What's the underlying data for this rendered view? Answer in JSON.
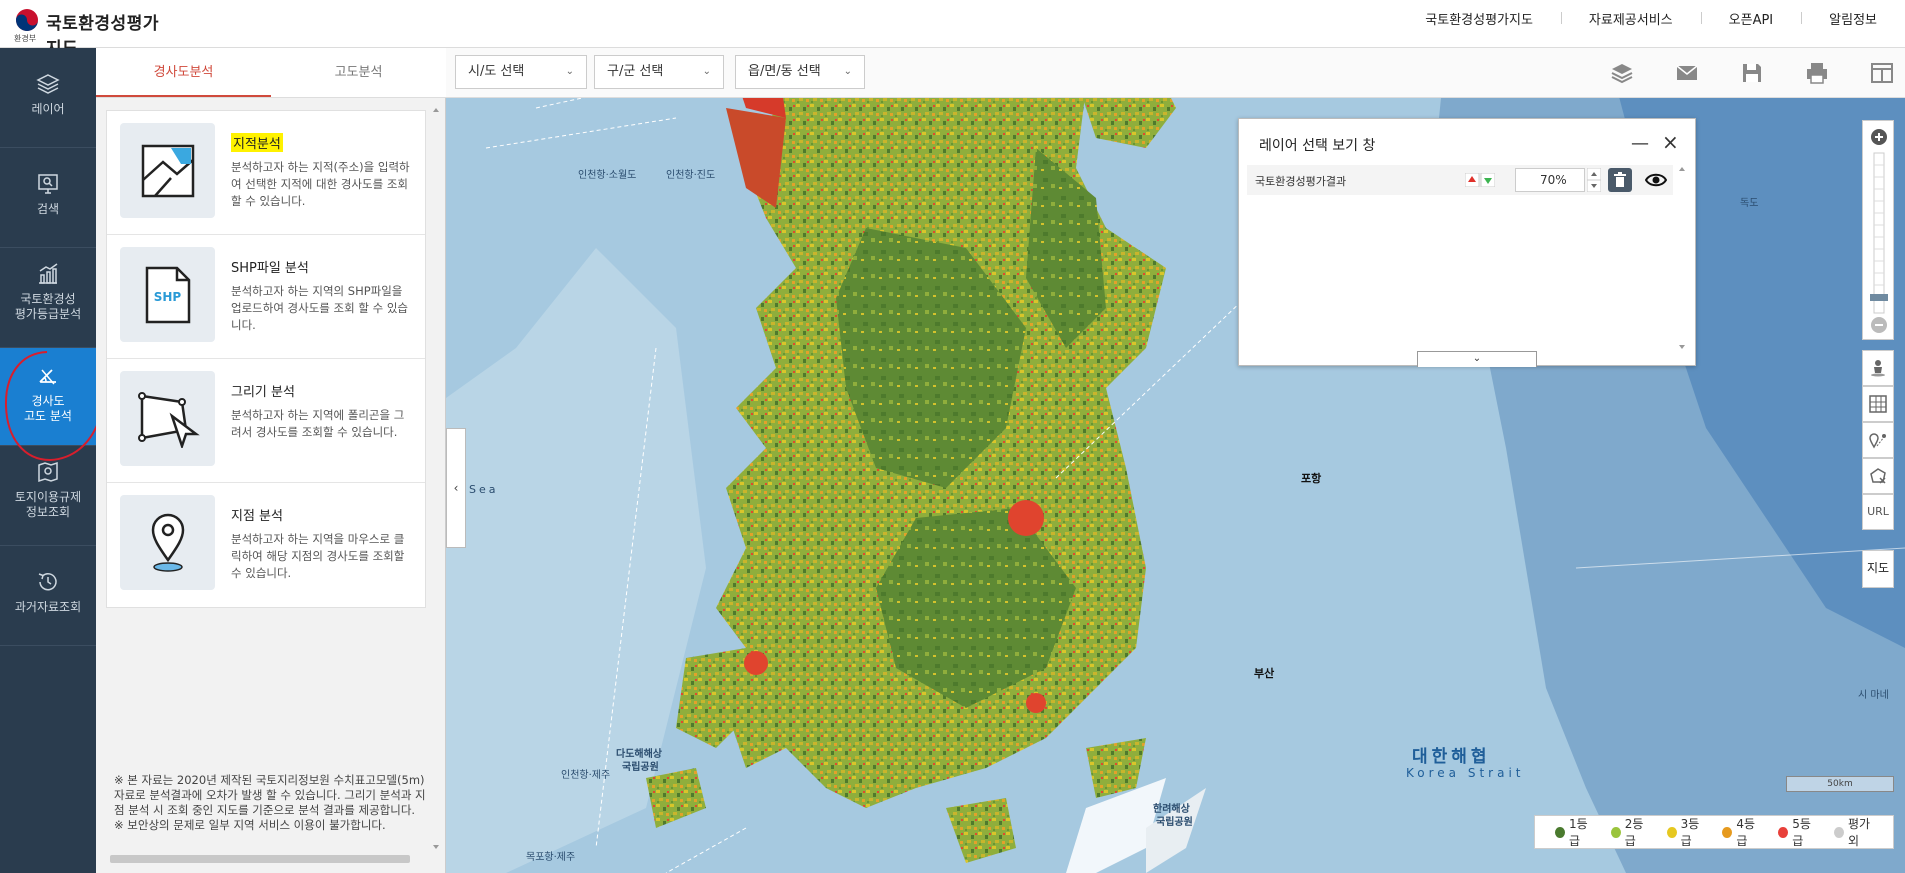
{
  "header": {
    "ministry": "환경부",
    "title": "국토환경성평가지도",
    "nav": [
      "국토환경성평가지도",
      "자료제공서비스",
      "오픈API",
      "알림정보"
    ]
  },
  "leftnav": {
    "layer": "레이어",
    "search": "검색",
    "grade_line1": "국토환경성",
    "grade_line2": "평가등급분석",
    "slope_line1": "경사도",
    "slope_line2": "고도 분석",
    "land_line1": "토지이용규제",
    "land_line2": "정보조회",
    "history": "과거자료조회"
  },
  "panel": {
    "tabs": [
      "경사도분석",
      "고도분석"
    ],
    "cards": [
      {
        "title": "지적분석",
        "desc": "분석하고자 하는 지적(주소)을 입력하여 선택한 지적에 대한 경사도를 조회할 수 있습니다."
      },
      {
        "title": "SHP파일 분석",
        "desc": "분석하고자 하는 지역의 SHP파일을 업로드하여 경사도를 조회 할 수 있습니다."
      },
      {
        "title": "그리기 분석",
        "desc": "분석하고자 하는 지역에 폴리곤을 그려서 경사도를 조회할 수 있습니다."
      },
      {
        "title": "지점 분석",
        "desc": "분석하고자 하는 지역을 마우스로 클릭하여 해당 지점의 경사도를 조회할 수 있습니다."
      }
    ],
    "shp_label": "SHP",
    "notice1": "※ 본 자료는 2020년 제작된 국토지리정보원 수치표고모델(5m) 자료로 분석결과에 오차가 발생 할 수 있습니다. 그리기 분석과 지점 분석 시 조회 중인 지도를 기준으로 분석 결과를 제공합니다.",
    "notice2": "※ 보안상의 문제로 일부 지역 서비스 이용이 불가합니다."
  },
  "toolbar": {
    "sido": "시/도 선택",
    "gugun": "구/군 선택",
    "dong": "읍/면/동 선택"
  },
  "layer_window": {
    "title": "레이어 선택 보기 창",
    "layer_name": "국토환경성평가결과",
    "opacity": "70%"
  },
  "map": {
    "labels": {
      "incheon1": "인천항·소월도",
      "incheon2": "인천항·진도",
      "sea": "Sea",
      "pohang": "포항",
      "busan": "부산",
      "dokdo": "독도",
      "korea_strait_ko": "대한해협",
      "korea_strait_en": "Korea Strait",
      "dadohae": "다도해해상",
      "dadohae2": "국립공원",
      "hallyeo": "한려해상",
      "hallyeo2": "국립공원",
      "tsushima": "시 마네",
      "route1": "인천항·제주",
      "route2": "목포항·제주"
    },
    "right_controls": {
      "url": "URL",
      "map": "지도"
    },
    "scale": "50km"
  },
  "legend": [
    {
      "label": "1등급",
      "color": "#4a7a2e"
    },
    {
      "label": "2등급",
      "color": "#9ac43c"
    },
    {
      "label": "3등급",
      "color": "#e6c820"
    },
    {
      "label": "4등급",
      "color": "#e69a1e"
    },
    {
      "label": "5등급",
      "color": "#e8403a"
    },
    {
      "label": "평가외",
      "color": "#cccccc"
    }
  ]
}
